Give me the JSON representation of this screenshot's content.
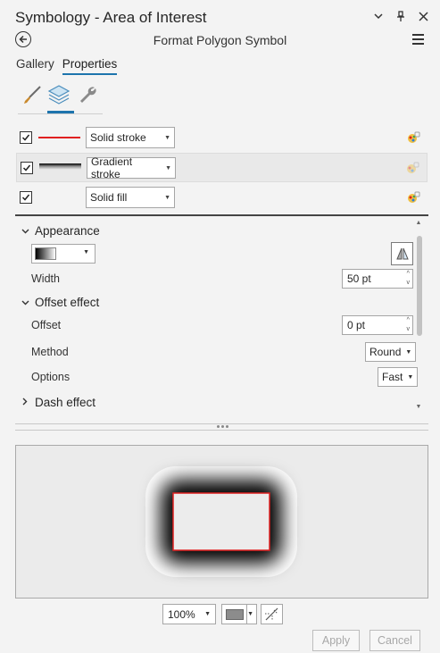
{
  "window": {
    "title": "Symbology - Area of Interest",
    "subtitle": "Format Polygon Symbol"
  },
  "tabs": [
    {
      "label": "Gallery",
      "active": false
    },
    {
      "label": "Properties",
      "active": true
    }
  ],
  "property_tabs": [
    {
      "icon": "paintbrush-icon",
      "active": false
    },
    {
      "icon": "layers-icon",
      "active": true
    },
    {
      "icon": "wrench-icon",
      "active": false
    }
  ],
  "layers": [
    {
      "checked": true,
      "type": "Solid stroke",
      "swatch": "red-line",
      "locked": false,
      "selected": false
    },
    {
      "checked": true,
      "type": "Gradient stroke",
      "swatch": "gradient-line",
      "locked": true,
      "selected": true
    },
    {
      "checked": true,
      "type": "Solid fill",
      "swatch": "none",
      "locked": false,
      "selected": false
    }
  ],
  "appearance": {
    "header": "Appearance",
    "width_label": "Width",
    "width_value": "50 pt"
  },
  "offset_effect": {
    "header": "Offset effect",
    "offset_label": "Offset",
    "offset_value": "0 pt",
    "method_label": "Method",
    "method_value": "Round",
    "options_label": "Options",
    "options_value": "Fast"
  },
  "dash_effect": {
    "header": "Dash effect"
  },
  "preview": {
    "zoom": "100%",
    "background_color": "#8c8c8c",
    "outline_color": "#e02020",
    "fill_color": "#ececec"
  },
  "buttons": {
    "apply": "Apply",
    "cancel": "Cancel"
  },
  "colors": {
    "accent": "#1d74ad",
    "red_stroke": "#e02020"
  }
}
